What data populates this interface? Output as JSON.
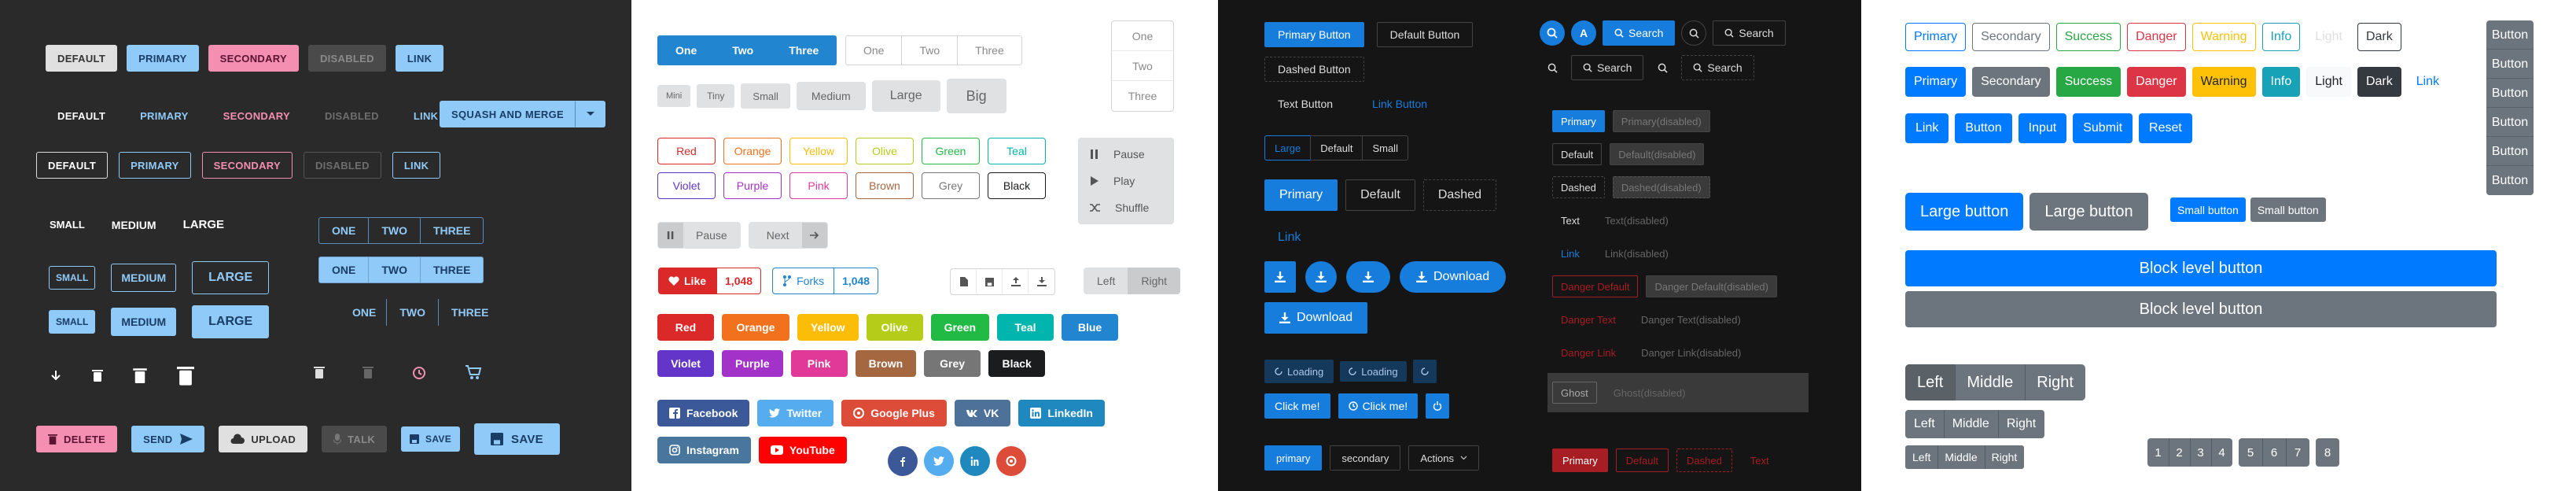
{
  "p1": {
    "row1": [
      "DEFAULT",
      "PRIMARY",
      "SECONDARY",
      "DISABLED",
      "LINK"
    ],
    "row2": [
      "DEFAULT",
      "PRIMARY",
      "SECONDARY",
      "DISABLED",
      "LINK"
    ],
    "split_label": "SQUASH AND MERGE",
    "row3": [
      "DEFAULT",
      "PRIMARY",
      "SECONDARY",
      "DISABLED",
      "LINK"
    ],
    "sizes": [
      "SMALL",
      "MEDIUM",
      "LARGE"
    ],
    "outline_sizes": [
      "SMALL",
      "MEDIUM",
      "LARGE"
    ],
    "filled_sizes": [
      "SMALL",
      "MEDIUM",
      "LARGE"
    ],
    "groups": [
      "ONE",
      "TWO",
      "THREE"
    ],
    "bottom": [
      "DELETE",
      "SEND",
      "UPLOAD",
      "TALK",
      "SAVE",
      "SAVE"
    ]
  },
  "p2": {
    "seg": [
      "One",
      "Two",
      "Three"
    ],
    "seg_outline": [
      "One",
      "Two",
      "Three"
    ],
    "vertical": [
      "One",
      "Two",
      "Three"
    ],
    "sizes": [
      "Mini",
      "Tiny",
      "Small",
      "Medium",
      "Large",
      "Big"
    ],
    "colors_outline": [
      "Red",
      "Orange",
      "Yellow",
      "Olive",
      "Green",
      "Teal",
      "Violet",
      "Purple",
      "Pink",
      "Brown",
      "Grey",
      "Black"
    ],
    "media": [
      "Pause",
      "Play",
      "Shuffle"
    ],
    "pause_label": "Pause",
    "next_label": "Next",
    "like_label": "Like",
    "like_count": "1,048",
    "forks_label": "Forks",
    "forks_count": "1,048",
    "lr": [
      "Left",
      "Right"
    ],
    "colors_filled": [
      "Red",
      "Orange",
      "Yellow",
      "Olive",
      "Green",
      "Teal",
      "Blue",
      "Violet",
      "Purple",
      "Pink",
      "Brown",
      "Grey",
      "Black"
    ],
    "social": [
      "Facebook",
      "Twitter",
      "Google Plus",
      "VK",
      "LinkedIn",
      "Instagram",
      "YouTube"
    ]
  },
  "p3": {
    "r1": [
      "Primary Button",
      "Default Button"
    ],
    "dashed": "Dashed Button",
    "text": "Text Button",
    "link": "Link Button",
    "search": [
      "Search",
      "Search",
      "Search",
      "Search",
      "Search"
    ],
    "avatar_letter": "A",
    "sizes": [
      "Large",
      "Default",
      "Small"
    ],
    "r4": [
      "Primary",
      "Default",
      "Dashed"
    ],
    "link2": "Link",
    "download": "Download",
    "download2": "Download",
    "loading": [
      "Loading",
      "Loading"
    ],
    "click": [
      "Click me!",
      "Click me!"
    ],
    "pair": [
      "primary",
      "secondary",
      "Actions"
    ],
    "grid": [
      [
        "Primary",
        "Primary(disabled)"
      ],
      [
        "Default",
        "Default(disabled)"
      ],
      [
        "Dashed",
        "Dashed(disabled)"
      ],
      [
        "Text",
        "Text(disabled)"
      ],
      [
        "Link",
        "Link(disabled)"
      ],
      [
        "Danger Default",
        "Danger Default(disabled)"
      ],
      [
        "Danger Text",
        "Danger Text(disabled)"
      ],
      [
        "Danger Link",
        "Danger Link(disabled)"
      ],
      [
        "Ghost",
        "Ghost(disabled)"
      ]
    ],
    "bottom": [
      "Primary",
      "Default",
      "Dashed",
      "Text"
    ]
  },
  "p4": {
    "outline": [
      "Primary",
      "Secondary",
      "Success",
      "Danger",
      "Warning",
      "Info",
      "Light",
      "Dark"
    ],
    "filled": [
      "Primary",
      "Secondary",
      "Success",
      "Danger",
      "Warning",
      "Info",
      "Light",
      "Dark",
      "Link"
    ],
    "types": [
      "Link",
      "Button",
      "Input",
      "Submit",
      "Reset"
    ],
    "large": [
      "Large button",
      "Large button"
    ],
    "small": [
      "Small button",
      "Small button"
    ],
    "block": [
      "Block level button",
      "Block level button"
    ],
    "vertical": [
      "Button",
      "Button",
      "Button",
      "Button",
      "Button",
      "Button"
    ],
    "lmr": [
      "Left",
      "Middle",
      "Right"
    ],
    "lmr_md": [
      "Left",
      "Middle",
      "Right"
    ],
    "lmr_sm": [
      "Left",
      "Middle",
      "Right"
    ],
    "pages": [
      "1",
      "2",
      "3",
      "4",
      "5",
      "6",
      "7",
      "8"
    ]
  }
}
